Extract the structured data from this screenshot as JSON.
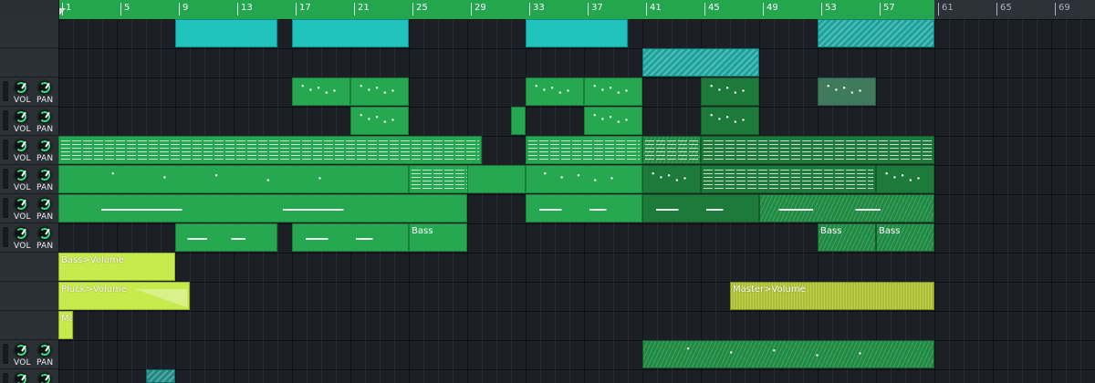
{
  "ruler": {
    "ticks": [
      "1",
      "5",
      "9",
      "13",
      "17",
      "21",
      "25",
      "29",
      "33",
      "37",
      "41",
      "45",
      "49",
      "53",
      "57",
      "61",
      "65",
      "69"
    ]
  },
  "track_controls": {
    "vol_label": "VOL",
    "pan_label": "PAN"
  },
  "clips": {
    "bass_volume": "Bass>Volume",
    "pluck_volume": "Pluck>Volume",
    "master_volume": "Master>Volume",
    "ma_short": "Ma",
    "bass": "Bass"
  },
  "colors": {
    "accent_green": "#23a64d",
    "clip_cyan": "#20c3bd",
    "clip_lime": "#c7ea4d",
    "knob_ring": "#3ddc84"
  }
}
